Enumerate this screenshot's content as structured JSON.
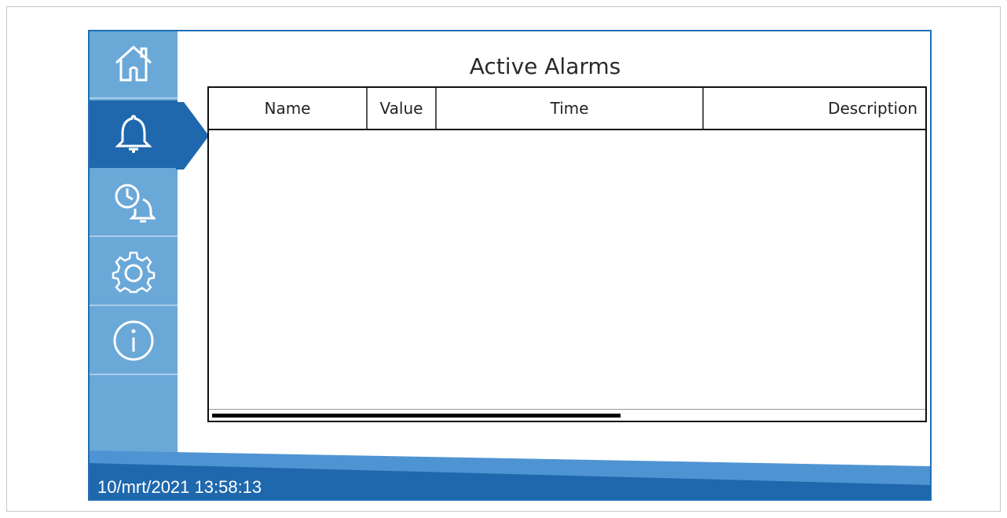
{
  "title": "Active Alarms",
  "navigation": {
    "active": "alarms",
    "items": [
      {
        "icon": "home-icon"
      },
      {
        "icon": "bell-icon"
      },
      {
        "icon": "alarm-history-icon"
      },
      {
        "icon": "gear-icon"
      },
      {
        "icon": "info-icon"
      }
    ]
  },
  "table": {
    "columns": [
      "Name",
      "Value",
      "Time",
      "Description"
    ]
  },
  "footer": {
    "datetime": "10/mrt/2021 13:58:13"
  },
  "colors": {
    "sidebar": "#6aa8d8",
    "active": "#1f68ad",
    "footer_dark": "#1f68ad",
    "footer_light": "#4f94d2"
  }
}
